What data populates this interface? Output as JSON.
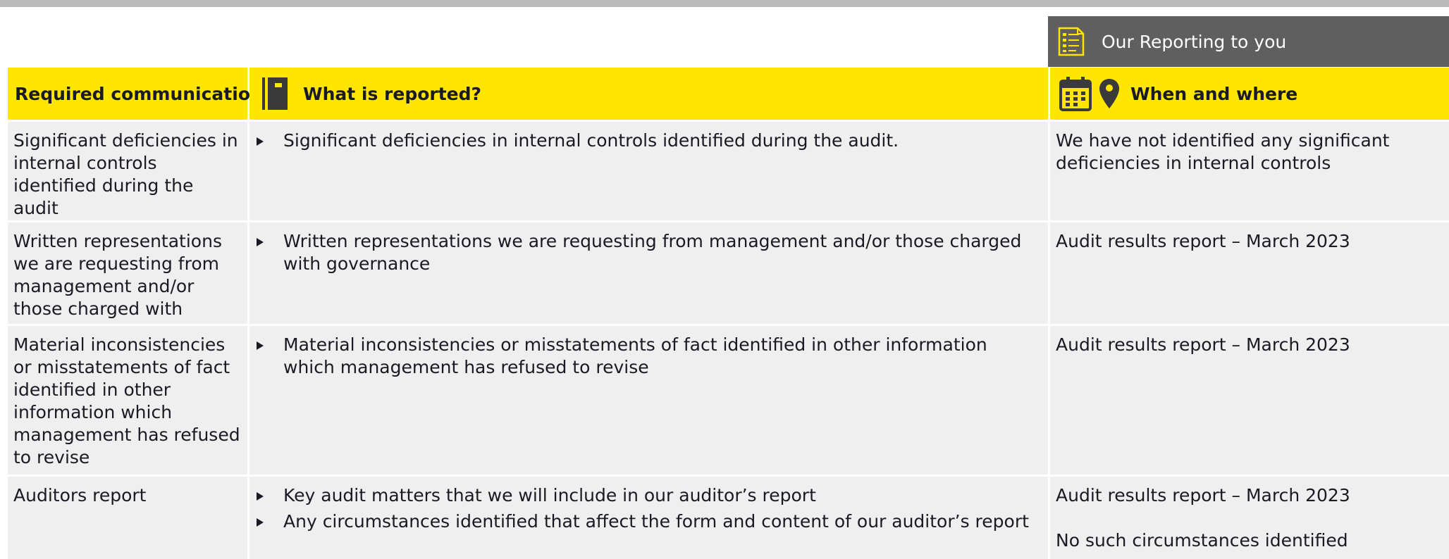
{
  "report_header": {
    "title": "Our Reporting to you",
    "icon": "checklist-icon"
  },
  "table": {
    "headers": {
      "required": "Required communications",
      "what": "What is reported?",
      "when": "When and where"
    },
    "rows": [
      {
        "required": "Significant deficiencies in internal controls identified during the audit",
        "what": [
          "Significant deficiencies in internal controls identified during the audit."
        ],
        "when": [
          "We have not identified any significant deficiencies in internal controls"
        ]
      },
      {
        "required": "Written representations we are requesting from management and/or those charged with governance",
        "what": [
          "Written representations we are requesting from management and/or those charged with governance"
        ],
        "when": [
          "Audit results report – March 2023"
        ]
      },
      {
        "required": "Material inconsistencies or misstatements of fact identified in other information which management has refused to revise",
        "what": [
          "Material inconsistencies or misstatements of fact identified in other information which management has refused to revise"
        ],
        "when": [
          "Audit results report – March 2023"
        ]
      },
      {
        "required": "Auditors report",
        "what": [
          "Key audit matters that we will include in our auditor’s report",
          "Any circumstances identified that affect the form and content of our auditor’s report"
        ],
        "when": [
          "Audit results report – March 2023",
          "No such circumstances identified"
        ]
      }
    ]
  },
  "colors": {
    "accent": "#ffe600",
    "header_dark": "#5f5f5f",
    "row_bg": "#efefef",
    "rule": "#b9b9b9"
  }
}
